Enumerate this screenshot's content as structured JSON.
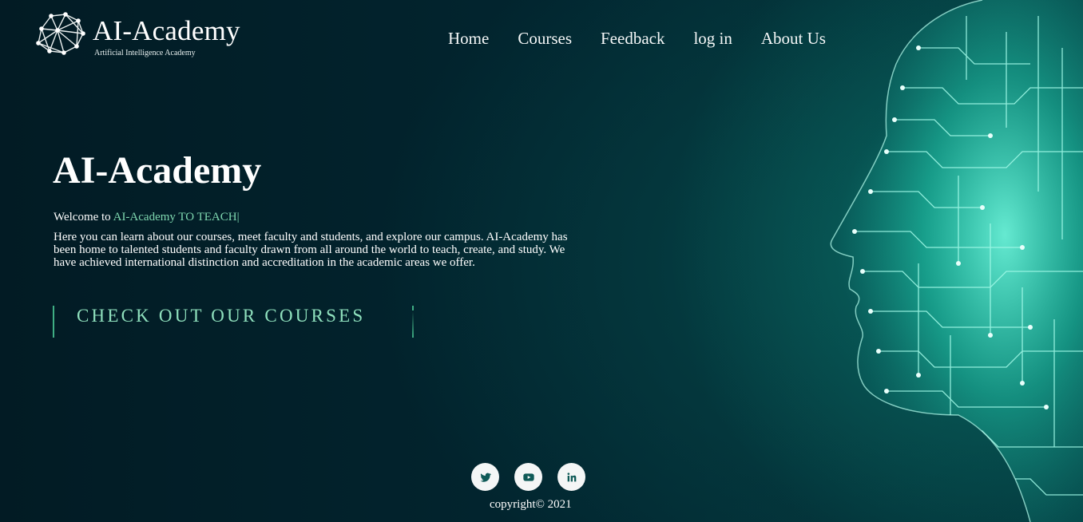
{
  "brand": {
    "title": "AI-Academy",
    "subtitle": "Artificial Intelligence Academy",
    "logo_icon": "network-brain-icon"
  },
  "nav": {
    "items": [
      {
        "label": "Home"
      },
      {
        "label": "Courses"
      },
      {
        "label": "Feedback"
      },
      {
        "label": "log in"
      },
      {
        "label": "About Us"
      }
    ]
  },
  "hero": {
    "title": "AI-Academy",
    "welcome_prefix": "Welcome to ",
    "welcome_accent": "AI-Academy TO TEACH",
    "caret": "|",
    "description": "Here you can learn about our courses, meet faculty and students, and explore our campus. AI-Academy has been home to talented students and faculty drawn from all around the world to teach, create, and study. We have achieved international distinction and accreditation in the academic areas we offer.",
    "cta_label": "CHECK OUT OUR COURSES"
  },
  "footer": {
    "social": [
      {
        "icon": "twitter-icon"
      },
      {
        "icon": "youtube-icon"
      },
      {
        "icon": "linkedin-icon"
      }
    ],
    "copyright": "copyright© 2021"
  },
  "colors": {
    "background": "#02202a",
    "accent": "#7fd8b0",
    "icon": "#0f5a57"
  }
}
